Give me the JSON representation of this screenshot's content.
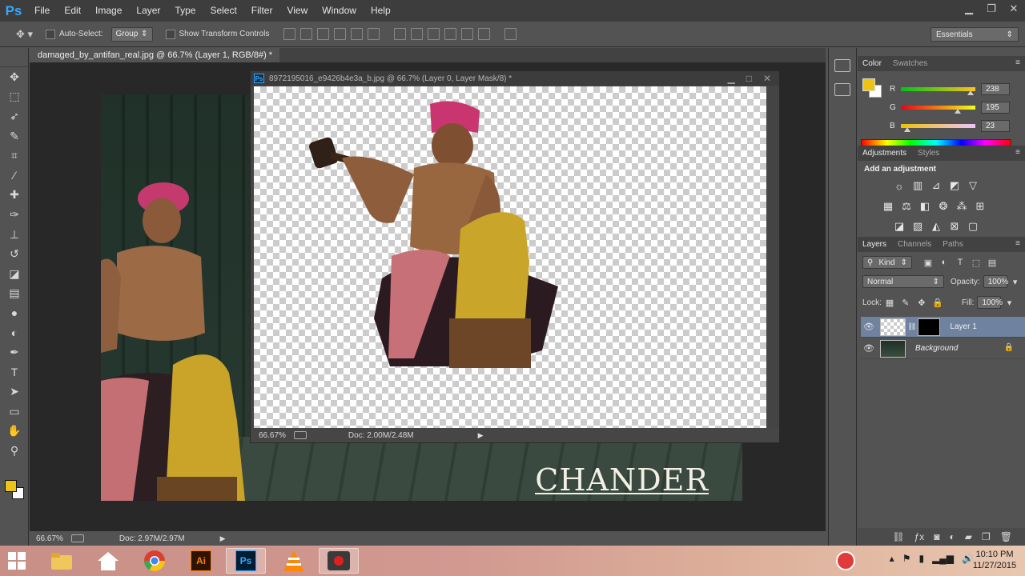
{
  "app": {
    "logo": "Ps"
  },
  "menu": [
    "File",
    "Edit",
    "Image",
    "Layer",
    "Type",
    "Select",
    "Filter",
    "View",
    "Window",
    "Help"
  ],
  "window_controls": {
    "minimize": "▁",
    "restore": "❐",
    "close": "✕"
  },
  "options_bar": {
    "auto_select_label": "Auto-Select:",
    "auto_select_value": "Group",
    "transform_controls_label": "Show Transform Controls",
    "workspace": "Essentials"
  },
  "document": {
    "tab_title": "damaged_by_antifan_real.jpg @ 66.7% (Layer 1, RGB/8#) *",
    "tab_close": "×",
    "watermark_text": "CHANDER",
    "status": {
      "zoom": "66.67%",
      "doc_size": "Doc: 2.97M/2.97M"
    }
  },
  "floating_document": {
    "title": "8972195016_e9426b4e3a_b.jpg @ 66.7% (Layer 0, Layer Mask/8) *",
    "status": {
      "zoom": "66.67%",
      "doc_size": "Doc: 2.00M/2.48M"
    }
  },
  "color_panel": {
    "tabs": [
      "Color",
      "Swatches"
    ],
    "foreground": "#eec317",
    "background": "#ffffff",
    "channels": [
      {
        "label": "R",
        "value": "238",
        "fraction": 0.933
      },
      {
        "label": "G",
        "value": "195",
        "fraction": 0.765
      },
      {
        "label": "B",
        "value": "23",
        "fraction": 0.09
      }
    ]
  },
  "adjustments_panel": {
    "tabs": [
      "Adjustments",
      "Styles"
    ],
    "title": "Add an adjustment"
  },
  "layers_panel": {
    "tabs": [
      "Layers",
      "Channels",
      "Paths"
    ],
    "filter_kind": "Kind",
    "blend_mode": "Normal",
    "opacity_label": "Opacity:",
    "opacity_value": "100%",
    "lock_label": "Lock:",
    "fill_label": "Fill:",
    "fill_value": "100%",
    "layers": [
      {
        "name": "Layer 1",
        "selected": true,
        "has_mask": true
      },
      {
        "name": "Background",
        "selected": false,
        "locked": true
      }
    ]
  },
  "taskbar": {
    "clock_time": "10:10 PM",
    "clock_date": "11/27/2015"
  }
}
